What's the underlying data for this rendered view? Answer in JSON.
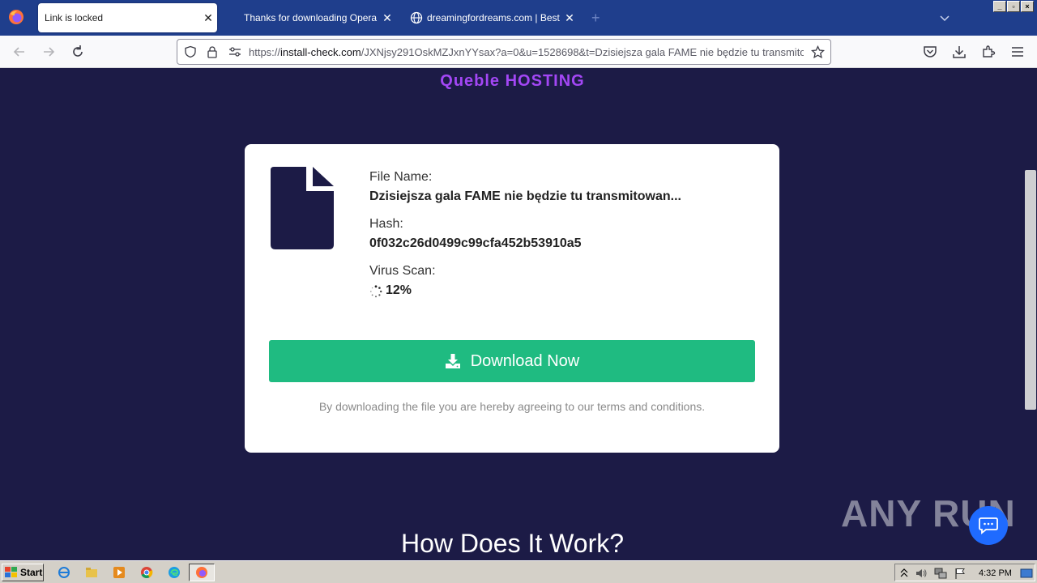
{
  "browser": {
    "tabs": [
      {
        "label": "Link is locked",
        "active": true
      },
      {
        "label": "Thanks for downloading Opera",
        "active": false
      },
      {
        "label": "dreamingfordreams.com | Best dre",
        "active": false
      }
    ],
    "new_tab": "+",
    "url": {
      "prefix": "https://",
      "domain": "install-check.com",
      "path": "/JXNjsy291OskMZJxnYYsax?a=0&u=1528698&t=Dzisiejsza gala FAME nie będzie tu transmitowa"
    },
    "window_buttons": [
      "_",
      "▫",
      "×"
    ]
  },
  "page": {
    "brand": "Queble HOSTING",
    "card": {
      "file_name_label": "File Name:",
      "file_name": "Dzisiejsza gala FAME nie będzie tu transmitowan...",
      "hash_label": "Hash:",
      "hash": "0f032c26d0499c99cfa452b53910a5",
      "virus_scan_label": "Virus Scan:",
      "virus_scan_progress": "12%",
      "download_label": "Download Now",
      "terms": "By downloading the file you are hereby agreeing to our terms and conditions."
    },
    "how_title": "How Does It Work?",
    "watermark": "ANY RUN"
  },
  "taskbar": {
    "start_label": "Start",
    "clock": "4:32 PM"
  },
  "colors": {
    "page_bg": "#1c1b46",
    "brand": "#a347f5",
    "download_button": "#1fbb81",
    "tabstrip": "#1f3e8c"
  }
}
